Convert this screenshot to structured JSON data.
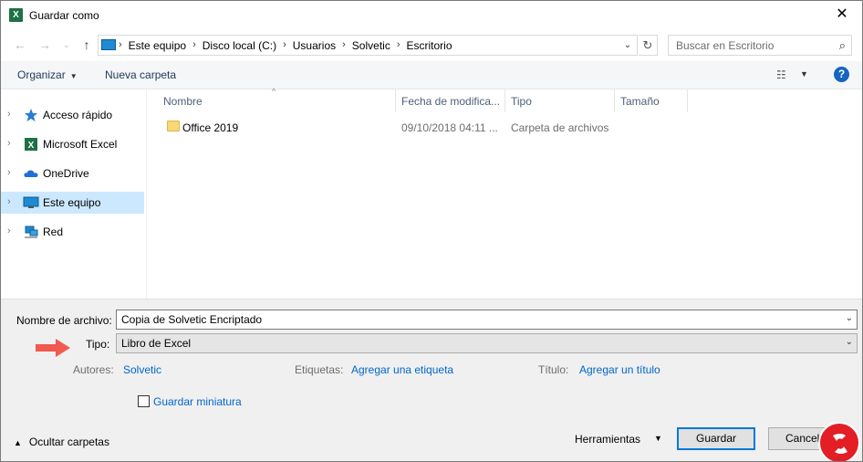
{
  "window": {
    "title": "Guardar como",
    "app_icon": "excel-icon"
  },
  "nav": {
    "back": "back-arrow-icon",
    "forward": "forward-arrow-icon",
    "recent": "chevron-down-icon",
    "up": "up-arrow-icon"
  },
  "address": {
    "breadcrumbs": [
      "Este equipo",
      "Disco local (C:)",
      "Usuarios",
      "Solvetic",
      "Escritorio"
    ]
  },
  "search": {
    "placeholder": "Buscar en Escritorio"
  },
  "toolbar": {
    "organize_label": "Organizar",
    "new_folder_label": "Nueva carpeta"
  },
  "sidebar": {
    "items": [
      {
        "label": "Acceso rápido",
        "icon": "star-icon",
        "selected": false
      },
      {
        "label": "Microsoft Excel",
        "icon": "excel-icon",
        "selected": false
      },
      {
        "label": "OneDrive",
        "icon": "cloud-icon",
        "selected": false
      },
      {
        "label": "Este equipo",
        "icon": "computer-icon",
        "selected": true
      },
      {
        "label": "Red",
        "icon": "network-icon",
        "selected": false
      }
    ]
  },
  "files": {
    "columns": [
      "Nombre",
      "Fecha de modifica...",
      "Tipo",
      "Tamaño"
    ],
    "rows": [
      {
        "name": "Office 2019",
        "date": "09/10/2018 04:11 ...",
        "type": "Carpeta de archivos",
        "size": ""
      }
    ]
  },
  "form": {
    "filename_label": "Nombre de archivo:",
    "filename_value": "Copia de Solvetic Encriptado",
    "type_label": "Tipo:",
    "type_value": "Libro de Excel",
    "authors_label": "Autores:",
    "authors_value": "Solvetic",
    "tags_label": "Etiquetas:",
    "tags_value": "Agregar una etiqueta",
    "title_label": "Título:",
    "title_value": "Agregar un título",
    "thumbnail_label": "Guardar miniatura",
    "thumbnail_checked": false
  },
  "footer": {
    "hide_folders_label": "Ocultar carpetas",
    "tools_label": "Herramientas",
    "save_label": "Guardar",
    "cancel_label": "Cancelar"
  },
  "colors": {
    "accent": "#0078d7",
    "link": "#0066cc",
    "annotation_arrow": "#f05a4f",
    "selected_bg": "#cce8ff"
  }
}
